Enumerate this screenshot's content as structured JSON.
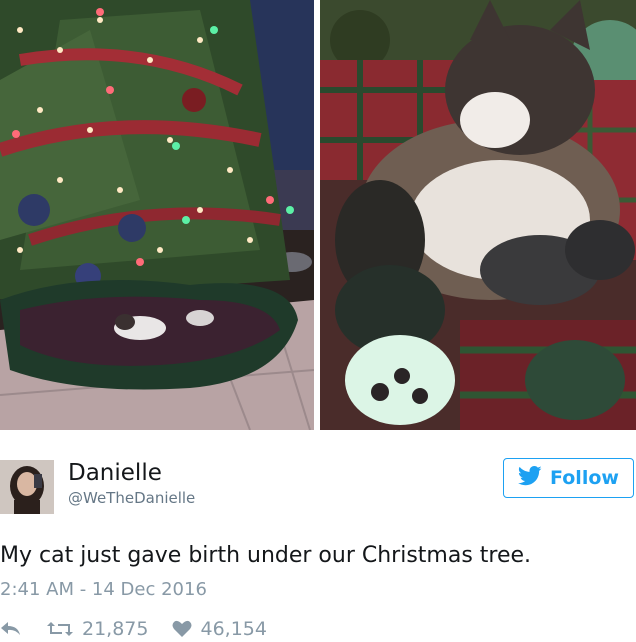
{
  "user": {
    "name": "Danielle",
    "handle": "@WeTheDanielle"
  },
  "follow_button": {
    "label": "Follow"
  },
  "tweet": {
    "text": "My cat just gave birth under our Christmas tree.",
    "timestamp": "2:41 AM - 14 Dec 2016"
  },
  "stats": {
    "retweets": "21,875",
    "likes": "46,154"
  },
  "icons": {
    "follow": "twitter-bird-icon",
    "reply": "reply-icon",
    "retweet": "retweet-icon",
    "like": "heart-icon"
  },
  "colors": {
    "accent": "#1da1f2",
    "muted": "#8899a6",
    "handle": "#657786",
    "text": "#14171a"
  }
}
